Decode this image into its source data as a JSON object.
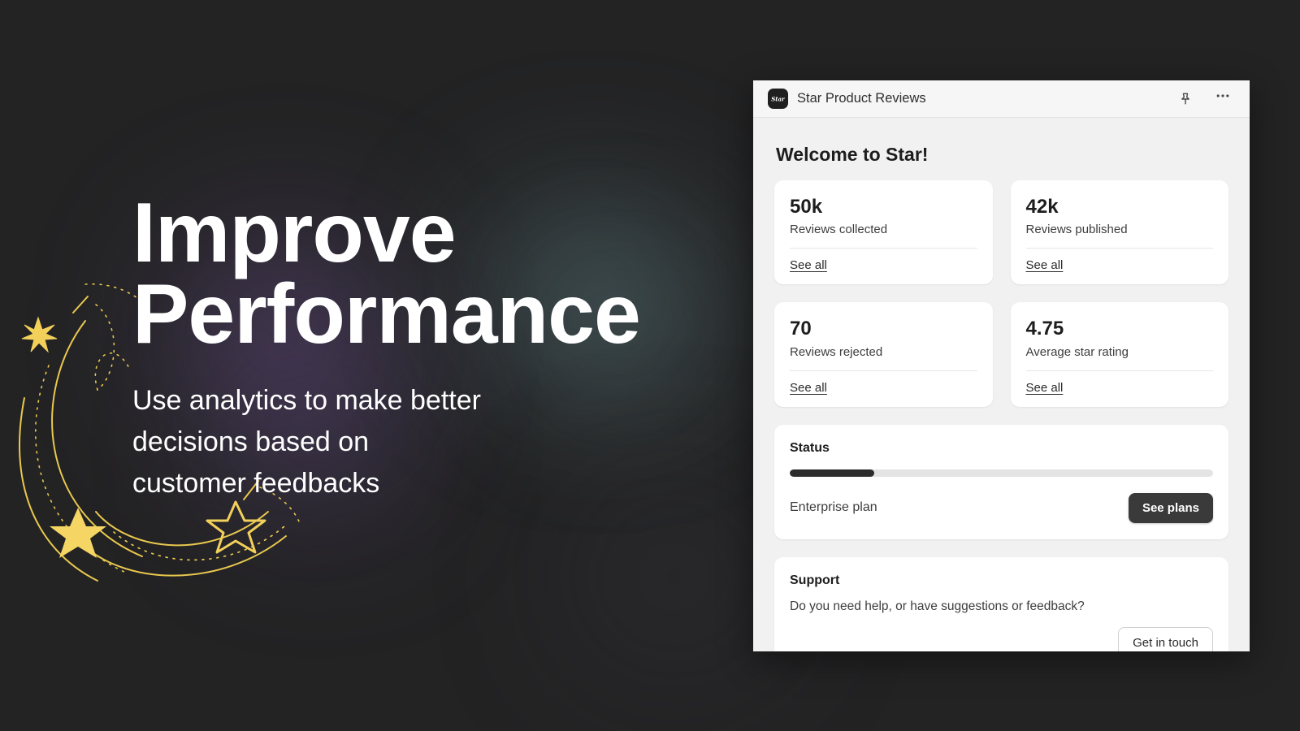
{
  "hero": {
    "title": "Improve\nPerformance",
    "subtitle": "Use analytics to make better\ndecisions based on\ncustomer feedbacks"
  },
  "colors": {
    "background": "#232324",
    "glow_purple": "#7e5ca8",
    "glow_teal": "#78aab2",
    "star_gold": "#f2d05a",
    "panel_bg": "#f1f1f1",
    "card_bg": "#ffffff",
    "accent_dark": "#3a3a3a"
  },
  "panel": {
    "header": {
      "app_name": "Star Product Reviews",
      "logo_text": "Star",
      "pin_icon": "pin-icon",
      "more_icon": "ellipsis-icon"
    },
    "welcome_heading": "Welcome to Star!",
    "stats": [
      {
        "value": "50k",
        "label": "Reviews collected",
        "link": "See all"
      },
      {
        "value": "42k",
        "label": "Reviews published",
        "link": "See all"
      },
      {
        "value": "70",
        "label": "Reviews rejected",
        "link": "See all"
      },
      {
        "value": "4.75",
        "label": "Average star rating",
        "link": "See all"
      }
    ],
    "status": {
      "title": "Status",
      "progress_percent": 20,
      "plan_label": "Enterprise plan",
      "button_label": "See plans"
    },
    "support": {
      "title": "Support",
      "text": "Do you need help, or have suggestions or feedback?",
      "button_label": "Get in touch"
    }
  }
}
